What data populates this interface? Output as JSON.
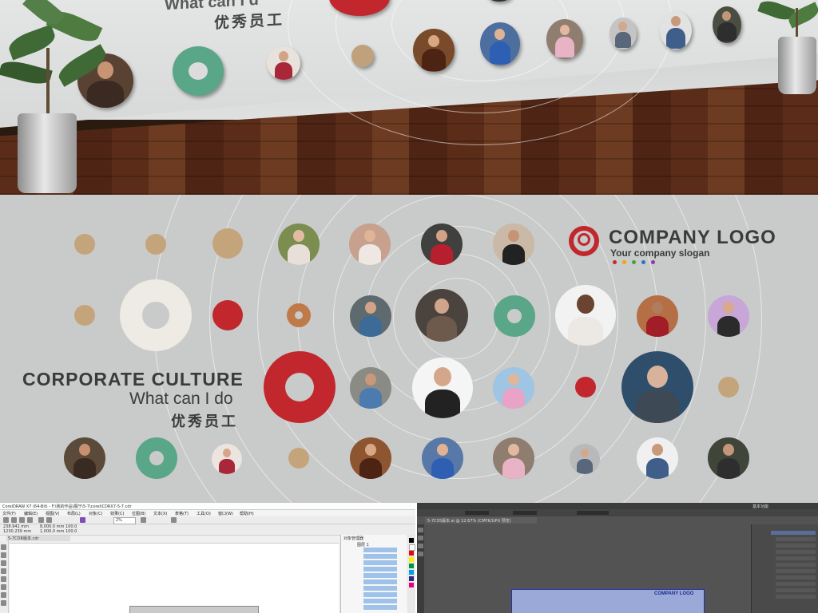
{
  "photo": {
    "wall_heading_partial": "What can I d",
    "wall_heading_cn": "优秀员工"
  },
  "design": {
    "headline": "CORPORATE CULTURE",
    "subheadline": "What can I do",
    "headline_cn": "优秀员工",
    "logo_text": "COMPANY LOGO",
    "logo_slogan": "Your company slogan",
    "colors": {
      "background": "#c9caca",
      "accent_red": "#c1272d",
      "accent_green": "#5aa688",
      "accent_tan": "#c4a47a",
      "text": "#3b3b3b"
    },
    "slogan_dots": [
      "#c1272d",
      "#f0a500",
      "#3ba935",
      "#2a73c8",
      "#8a3ca8"
    ]
  },
  "coreldraw": {
    "title": "CorelDRAW X7 (64-Bit) - F:\\我的作品\\展厅\\5-7\\corel\\CDRX7-5-7.cdr",
    "menu": [
      "文件(F)",
      "编辑(E)",
      "视图(V)",
      "布局(L)",
      "对象(C)",
      "效果(C)",
      "位图(B)",
      "文本(X)",
      "表格(T)",
      "工具(O)",
      "窗口(W)",
      "帮助(H)"
    ],
    "width_field": "238.941 mm",
    "height_field": "1230.239 mm",
    "size_field_1": "8,000.0 mm",
    "size_field_2": "1,000.0 mm",
    "scale_x": "100.0",
    "scale_y": "100.0",
    "zoom": "2%",
    "doc_tab": "5-7CDR版本.cdr",
    "panel_title": "对象管理器",
    "layer_label": "图层 1"
  },
  "illustrator": {
    "doc_tab": "5-7CS5版本.ai @ 12.67% (CMYK/GPU 预览)",
    "zoom": "12.67%",
    "workspace": "基本功能",
    "artboard_logo": "COMPANY LOGO"
  }
}
